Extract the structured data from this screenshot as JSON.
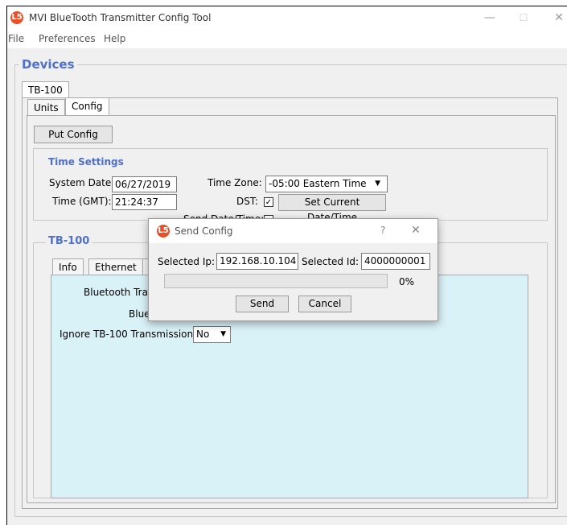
{
  "window": {
    "title": "MVI BlueTooth Transmitter Config Tool",
    "app_icon": "L5"
  },
  "winbuttons": {
    "minimize": "—",
    "maximize": "☐",
    "close": "✕"
  },
  "menu": [
    "File",
    "Preferences",
    "Help"
  ],
  "devices": {
    "legend": "Devices",
    "device_tab": "TB-100",
    "subtabs": [
      "Units",
      "Config"
    ],
    "put_config": "Put Config"
  },
  "time_settings": {
    "legend": "Time Settings",
    "system_date_label": "System Date:",
    "system_date": "06/27/2019",
    "time_label": "Time (GMT):",
    "time": "21:24:37",
    "timezone_label": "Time Zone:",
    "timezone": "-05:00 Eastern Time",
    "dst_label": "DST:",
    "dst_checked": true,
    "set_current": "Set Current Date/Time",
    "send_datetime_label": "Send Date/Time:"
  },
  "tb100": {
    "legend": "TB-100",
    "tabs": [
      "Info",
      "Ethernet"
    ],
    "bluetooth_tran_label": "Bluetooth Tran",
    "blue_label": "Blue",
    "ignore_label": "Ignore TB-100 Transmissions:",
    "ignore_value": "No"
  },
  "dialog": {
    "title": "Send Config",
    "help": "?",
    "close": "✕",
    "selected_ip_label": "Selected Ip:",
    "selected_ip": "192.168.10.104",
    "selected_id_label": "Selected Id:",
    "selected_id": "4000000001",
    "progress_text": "0%",
    "progress": 0,
    "send": "Send",
    "cancel": "Cancel"
  }
}
